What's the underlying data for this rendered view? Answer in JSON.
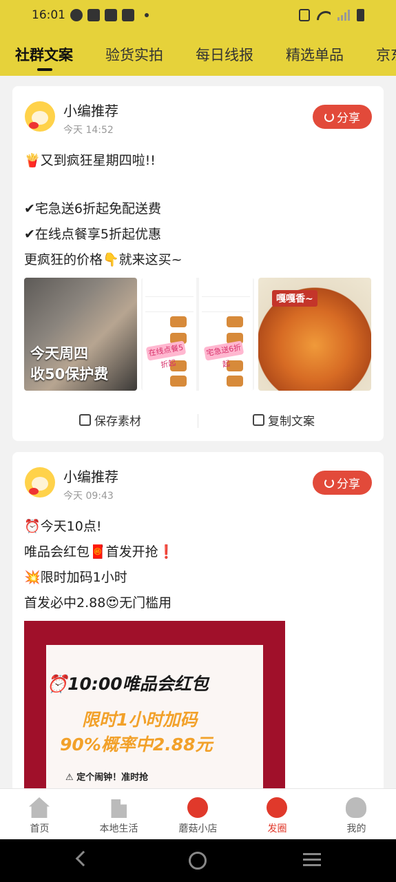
{
  "status": {
    "time": "16:01"
  },
  "tabs": [
    "社群文案",
    "验货实拍",
    "每日线报",
    "精选单品",
    "京东"
  ],
  "posts": [
    {
      "author": "小编推荐",
      "time": "今天 14:52",
      "share": "分享",
      "lines": [
        "🍟又到疯狂星期四啦!!",
        "✔宅急送6折起免配送费",
        "✔在线点餐享5折起优惠",
        "更疯狂的价格👇就来这买~"
      ],
      "img1_caption": [
        "今天周四",
        "收50保护费"
      ],
      "img2_tags": [
        "在线点餐5折起",
        "宅急送6折起"
      ],
      "img3_tag": "嘎嘎香~",
      "save": "保存素材",
      "copy": "复制文案"
    },
    {
      "author": "小编推荐",
      "time": "今天 09:43",
      "share": "分享",
      "lines": [
        "⏰今天10点!",
        "唯品会红包🧧首发开抢❗",
        "💥限时加码1小时",
        "首发必中2.88😍无门槛用"
      ],
      "poster": {
        "title": "⏰10:00唯品会红包",
        "sub1": "限时1小时加码",
        "sub2": "90%概率中2.88元",
        "note": "⚠ 定个闹钟！准时抢"
      }
    }
  ],
  "nav": [
    "首页",
    "本地生活",
    "蘑菇小店",
    "发圈",
    "我的"
  ],
  "nav_active": "发圈",
  "colors": {
    "header": "#e6d23a",
    "accent": "#e24a3a"
  }
}
